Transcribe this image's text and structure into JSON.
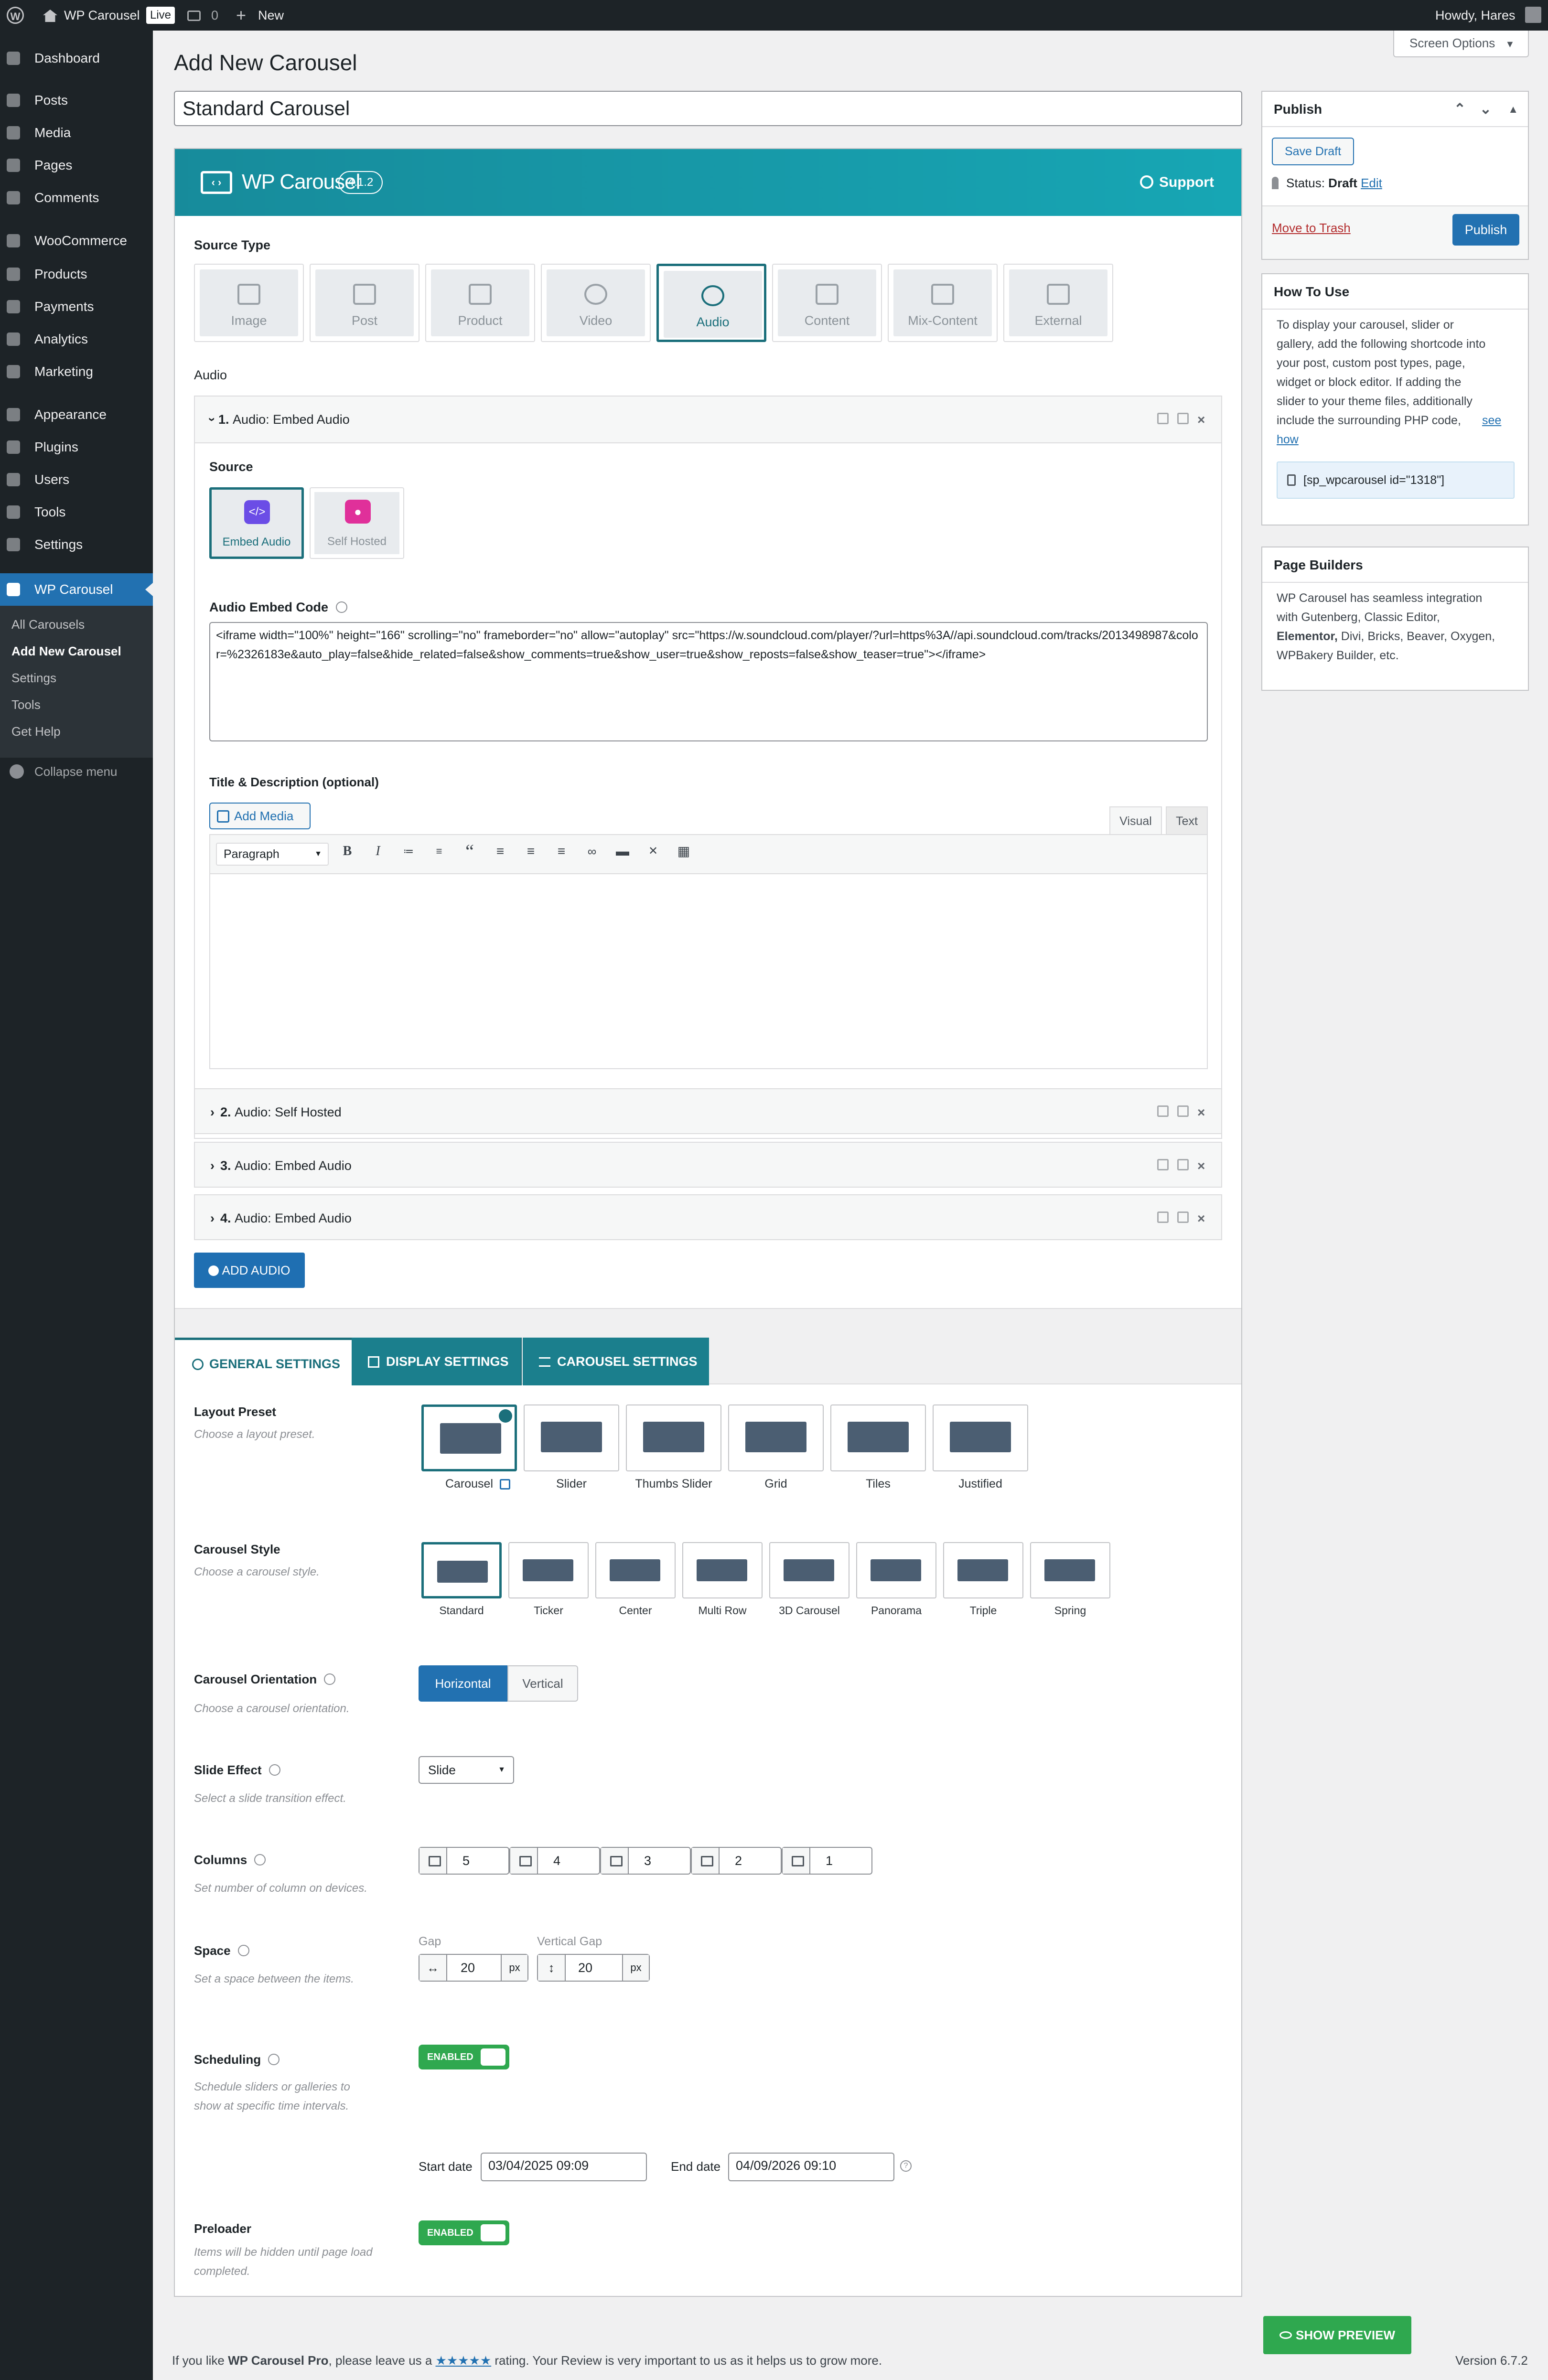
{
  "admin_bar": {
    "site_name": "WP Carousel",
    "live_badge": "Live",
    "comments_count": "0",
    "new_label": "New",
    "howdy": "Howdy, Hares"
  },
  "sidebar": {
    "items": [
      {
        "label": "Dashboard",
        "icon": "dashboard-icon"
      },
      {
        "label": "Posts",
        "icon": "pin-icon"
      },
      {
        "label": "Media",
        "icon": "media-icon"
      },
      {
        "label": "Pages",
        "icon": "pages-icon"
      },
      {
        "label": "Comments",
        "icon": "comment-icon"
      },
      {
        "label": "WooCommerce",
        "icon": "woo-icon"
      },
      {
        "label": "Products",
        "icon": "archive-icon"
      },
      {
        "label": "Payments",
        "icon": "dollar-icon"
      },
      {
        "label": "Analytics",
        "icon": "chart-icon"
      },
      {
        "label": "Marketing",
        "icon": "megaphone-icon"
      },
      {
        "label": "Appearance",
        "icon": "brush-icon"
      },
      {
        "label": "Plugins",
        "icon": "plugin-icon"
      },
      {
        "label": "Users",
        "icon": "users-icon"
      },
      {
        "label": "Tools",
        "icon": "wrench-icon"
      },
      {
        "label": "Settings",
        "icon": "settings-icon"
      },
      {
        "label": "WP Carousel",
        "icon": "carousel-icon"
      }
    ],
    "submenu": [
      "All Carousels",
      "Add New Carousel",
      "Settings",
      "Tools",
      "Get Help"
    ],
    "collapse": "Collapse menu"
  },
  "screen_options": "Screen Options",
  "page_title": "Add New Carousel",
  "post_title_value": "Standard Carousel",
  "plugin_header": {
    "logo_text": "WP Carousel",
    "version": "4.1.2",
    "support": "Support"
  },
  "source_type": {
    "label": "Source Type",
    "types": [
      "Image",
      "Post",
      "Product",
      "Video",
      "Audio",
      "Content",
      "Mix-Content",
      "External"
    ],
    "selected": "Audio"
  },
  "audio_section": {
    "label": "Audio",
    "open_item": {
      "num": "1.",
      "title": "Audio:  Embed Audio"
    },
    "source_label": "Source",
    "sources": [
      "Embed Audio",
      "Self Hosted"
    ],
    "embed_code_label": "Audio Embed Code",
    "embed_code_value": "<iframe width=\"100%\" height=\"166\" scrolling=\"no\" frameborder=\"no\" allow=\"autoplay\" src=\"https://w.soundcloud.com/player/?url=https%3A//api.soundcloud.com/tracks/2013498987&color=%2326183e&auto_play=false&hide_related=false&show_comments=true&show_user=true&show_reposts=false&show_teaser=true\"></iframe>",
    "title_desc_label": "Title & Description (optional)",
    "add_media": "Add Media",
    "visual_tab": "Visual",
    "text_tab": "Text",
    "format_select": "Paragraph",
    "closed_items": [
      {
        "num": "2.",
        "title": "Audio:  Self Hosted"
      },
      {
        "num": "3.",
        "title": "Audio:  Embed Audio"
      },
      {
        "num": "4.",
        "title": "Audio:  Embed Audio"
      }
    ],
    "add_button": "ADD AUDIO"
  },
  "settings_tabs": [
    "GENERAL SETTINGS",
    "DISPLAY SETTINGS",
    "CAROUSEL SETTINGS"
  ],
  "general": {
    "layout_preset": {
      "label": "Layout Preset",
      "desc": "Choose a layout preset.",
      "options": [
        "Carousel",
        "Slider",
        "Thumbs Slider",
        "Grid",
        "Tiles",
        "Justified"
      ]
    },
    "carousel_style": {
      "label": "Carousel Style",
      "desc": "Choose a carousel style.",
      "options": [
        "Standard",
        "Ticker",
        "Center",
        "Multi Row",
        "3D Carousel",
        "Panorama",
        "Triple",
        "Spring"
      ]
    },
    "orientation": {
      "label": "Carousel Orientation",
      "desc": "Choose a carousel orientation.",
      "options": [
        "Horizontal",
        "Vertical"
      ]
    },
    "slide_effect": {
      "label": "Slide Effect",
      "desc": "Select a slide transition effect.",
      "value": "Slide"
    },
    "columns": {
      "label": "Columns",
      "desc": "Set number of column on devices.",
      "values": [
        "5",
        "4",
        "3",
        "2",
        "1"
      ]
    },
    "space": {
      "label": "Space",
      "desc": "Set a space between the items.",
      "gap_label": "Gap",
      "gap_value": "20",
      "vgap_label": "Vertical Gap",
      "vgap_value": "20",
      "unit": "px"
    },
    "scheduling": {
      "label": "Scheduling",
      "desc_line1": "Schedule sliders or galleries to",
      "desc_line2": "show at specific time intervals.",
      "toggle": "ENABLED",
      "start_label": "Start date",
      "start_value": "03/04/2025 09:09",
      "end_label": "End date",
      "end_value": "04/09/2026 09:10"
    },
    "preloader": {
      "label": "Preloader",
      "desc_line1": "Items will be hidden until page load",
      "desc_line2": "completed.",
      "toggle": "ENABLED"
    }
  },
  "publish_box": {
    "title": "Publish",
    "save_draft": "Save Draft",
    "status_label": "Status:",
    "status_value": "Draft",
    "edit": "Edit",
    "trash": "Move to Trash",
    "publish": "Publish"
  },
  "how_to_use": {
    "title": "How To Use",
    "lines": [
      "To display your carousel, slider or",
      "gallery, add the following shortcode into",
      "your post, custom post types, page,",
      "widget or block editor. If adding the",
      "slider to your theme files, additionally",
      "include the surrounding PHP code,"
    ],
    "link1": "see",
    "link2": "how",
    "shortcode": "[sp_wpcarousel id=\"1318\"]"
  },
  "page_builders": {
    "title": "Page Builders",
    "line1": "WP Carousel has seamless integration",
    "line2": "with Gutenberg, Classic Editor,",
    "line3_bold": "Elementor,",
    "line3_rest": " Divi, Bricks, Beaver, Oxygen,",
    "line4": "WPBakery Builder, etc."
  },
  "show_preview": "SHOW PREVIEW",
  "footer": {
    "prefix": "If you like ",
    "product": "WP Carousel Pro",
    "middle": ", please leave us a ",
    "stars": "★★★★★",
    "suffix": " rating. Your Review is very important to us as it helps us to grow more.",
    "version": "Version 6.7.2"
  },
  "colors": {
    "accent_teal": "#1b6f7b",
    "wp_blue": "#2271b1",
    "enabled_green": "#2fa84f",
    "admin_dark": "#1d2327"
  }
}
